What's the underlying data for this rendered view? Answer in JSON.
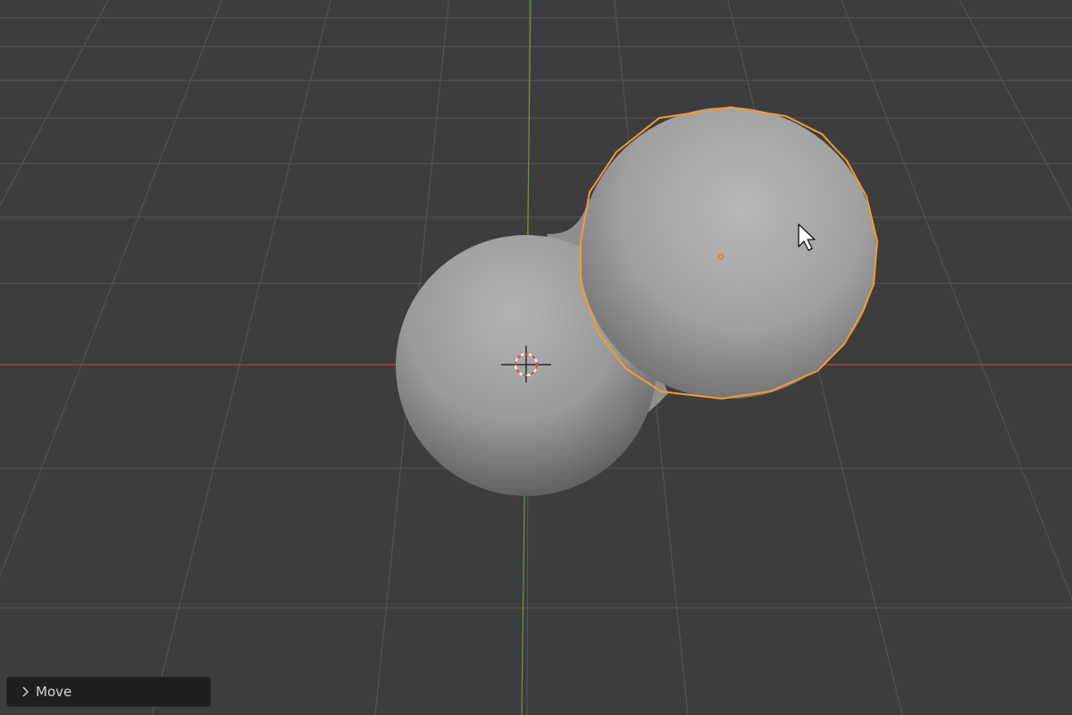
{
  "viewport": {
    "background_color": "#3d3d3d",
    "grid_color": "#575757",
    "x_axis_color": "#c33a4e",
    "y_axis_color": "#6a9a2e",
    "selection_outline_color": "#f29a36",
    "origin_dot_color": "#e07a1c",
    "mesh_color": "#a9a9a9"
  },
  "scene": {
    "objects": [
      {
        "name": "sphere",
        "selected": false
      },
      {
        "name": "sphere-selected",
        "selected": true
      }
    ],
    "cursor_3d": "3d-cursor-icon",
    "mouse_cursor": "mouse-pointer-icon"
  },
  "operator_panel": {
    "label": "Move",
    "icon": "chevron-right-icon",
    "collapsed": true
  }
}
